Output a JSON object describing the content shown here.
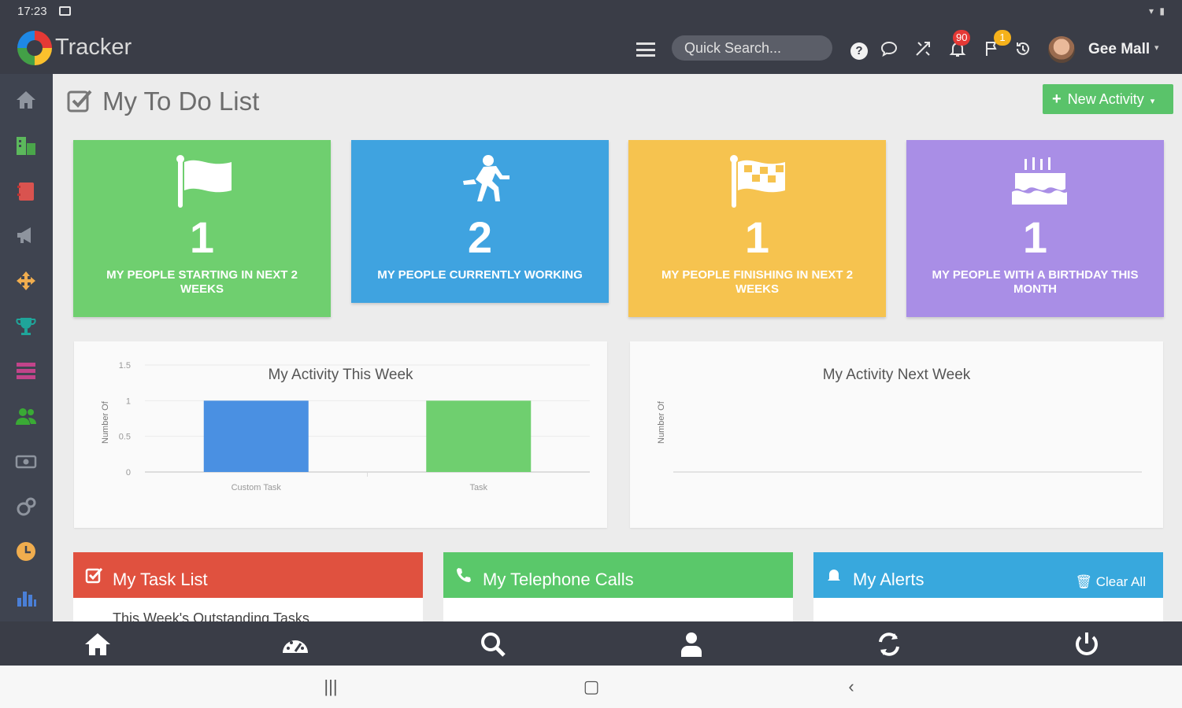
{
  "status": {
    "time": "17:23"
  },
  "app": {
    "logo_text": "Tracker"
  },
  "topnav": {
    "search_placeholder": "Quick Search...",
    "notifications_count": "90",
    "flags_count": "1",
    "user_name": "Gee Mall"
  },
  "page": {
    "title": "My To Do List",
    "new_activity_label": "New Activity"
  },
  "tiles": [
    {
      "number": "1",
      "label": "MY PEOPLE STARTING IN NEXT 2 WEEKS",
      "color": "#6fcf6f",
      "icon": "flag-icon"
    },
    {
      "number": "2",
      "label": "MY PEOPLE CURRENTLY WORKING",
      "color": "#3fa3e0",
      "icon": "running-icon"
    },
    {
      "number": "1",
      "label": "MY PEOPLE FINISHING IN NEXT 2 WEEKS",
      "color": "#f6c34f",
      "icon": "checkered-flag-icon"
    },
    {
      "number": "1",
      "label": "MY PEOPLE WITH A BIRTHDAY THIS MONTH",
      "color": "#a98ee6",
      "icon": "birthday-cake-icon"
    }
  ],
  "chart_data": [
    {
      "type": "bar",
      "title": "My Activity This Week",
      "ylabel": "Number Of",
      "categories": [
        "Custom Task",
        "Task"
      ],
      "values": [
        1,
        1
      ],
      "colors": [
        "#4a90e2",
        "#6fcf6f"
      ],
      "yticks": [
        "1.5",
        "1",
        "0.5",
        "0"
      ],
      "ylim": [
        0,
        1.5
      ],
      "grid": true
    },
    {
      "type": "bar",
      "title": "My Activity Next Week",
      "ylabel": "Number Of",
      "categories": [],
      "values": []
    }
  ],
  "widgets": {
    "tasks": {
      "title": "My Task List",
      "peek": "This Week's Outstanding Tasks"
    },
    "calls": {
      "title": "My Telephone Calls"
    },
    "alerts": {
      "title": "My Alerts",
      "clear_all": "Clear All"
    }
  }
}
